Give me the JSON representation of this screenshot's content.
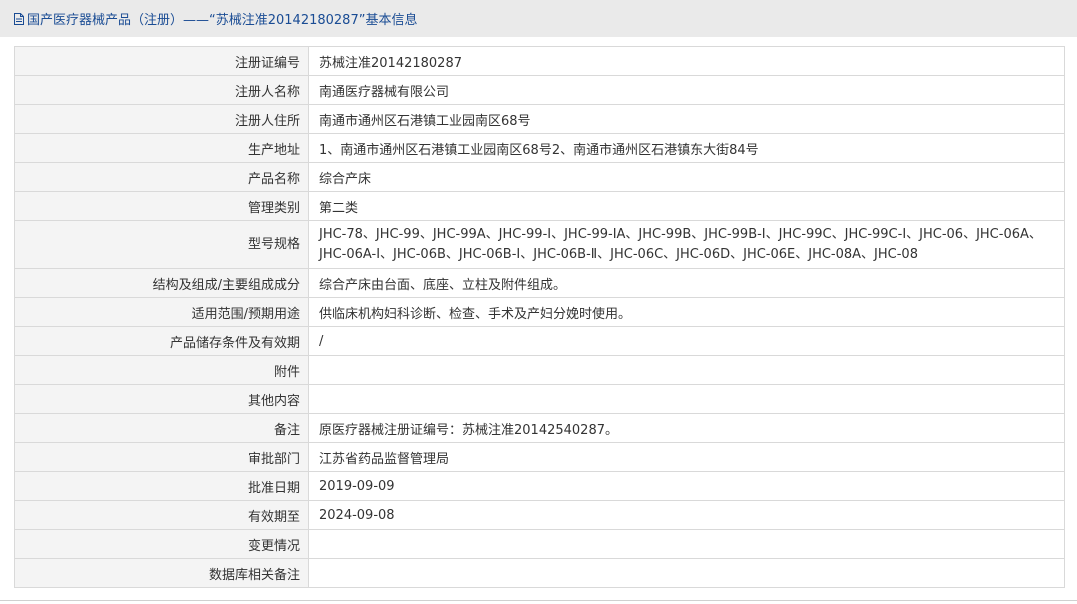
{
  "header": {
    "title": "国产医疗器械产品（注册）——“苏械注准20142180287”基本信息",
    "title_color": "#1a4c94",
    "icon": "document-icon"
  },
  "rows": [
    {
      "label": "注册证编号",
      "value": "苏械注准20142180287"
    },
    {
      "label": "注册人名称",
      "value": "南通医疗器械有限公司"
    },
    {
      "label": "注册人住所",
      "value": "南通市通州区石港镇工业园南区68号"
    },
    {
      "label": "生产地址",
      "value": "1、南通市通州区石港镇工业园南区68号2、南通市通州区石港镇东大街84号"
    },
    {
      "label": "产品名称",
      "value": "综合产床"
    },
    {
      "label": "管理类别",
      "value": "第二类"
    },
    {
      "label": "型号规格",
      "value": "JHC-78、JHC-99、JHC-99A、JHC-99-Ⅰ、JHC-99-ⅠA、JHC-99B、JHC-99B-Ⅰ、JHC-99C、JHC-99C-Ⅰ、JHC-06、JHC-06A、JHC-06A-Ⅰ、JHC-06B、JHC-06B-Ⅰ、JHC-06B-Ⅱ、JHC-06C、JHC-06D、JHC-06E、JHC-08A、JHC-08"
    },
    {
      "label": "结构及组成/主要组成成分",
      "value": "综合产床由台面、底座、立柱及附件组成。"
    },
    {
      "label": "适用范围/预期用途",
      "value": "供临床机构妇科诊断、检查、手术及产妇分娩时使用。"
    },
    {
      "label": "产品储存条件及有效期",
      "value": "/"
    },
    {
      "label": "附件",
      "value": ""
    },
    {
      "label": "其他内容",
      "value": ""
    },
    {
      "label": "备注",
      "value": "原医疗器械注册证编号：苏械注准20142540287。"
    },
    {
      "label": "审批部门",
      "value": "江苏省药品监督管理局"
    },
    {
      "label": "批准日期",
      "value": "2019-09-09"
    },
    {
      "label": "有效期至",
      "value": "2024-09-08"
    },
    {
      "label": "变更情况",
      "value": ""
    },
    {
      "label": "数据库相关备注",
      "value": ""
    }
  ]
}
